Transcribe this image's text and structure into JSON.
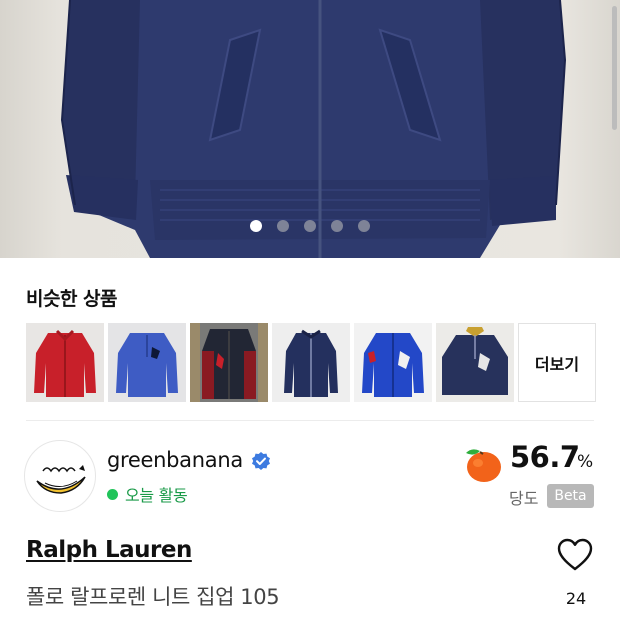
{
  "gallery": {
    "image_alt": "navy knit zip-up cardigan",
    "slide_count": 5,
    "active_slide": 1,
    "colors": {
      "knit": "#2e3a6e",
      "background": "#e6e3dd"
    }
  },
  "similar": {
    "title": "비슷한 상품",
    "more_label": "더보기",
    "items": [
      {
        "color": "#c8202a",
        "icon": "red-knit-zip-jacket"
      },
      {
        "color": "#3e5cc4",
        "icon": "blue-knit-half-zip"
      },
      {
        "color": "#222634",
        "icon": "black-knit-vest"
      },
      {
        "color": "#24305e",
        "icon": "navy-knit-zip-jacket"
      },
      {
        "color": "#2348c8",
        "icon": "royal-blue-knit-zip"
      },
      {
        "color": "#27325c",
        "icon": "navy-knit-half-zip"
      }
    ]
  },
  "seller": {
    "name": "greenbanana",
    "activity": "오늘 활동",
    "verified_icon": "verified-check-icon",
    "sweetness_score": "56.7",
    "sweetness_unit": "%",
    "sweetness_label": "당도",
    "beta_badge": "Beta",
    "colors": {
      "active": "#21c45a",
      "verified": "#3d7be0"
    }
  },
  "product": {
    "brand": "Ralph Lauren",
    "title": "폴로 랄프로렌 니트 집업 105",
    "likes": "24"
  }
}
